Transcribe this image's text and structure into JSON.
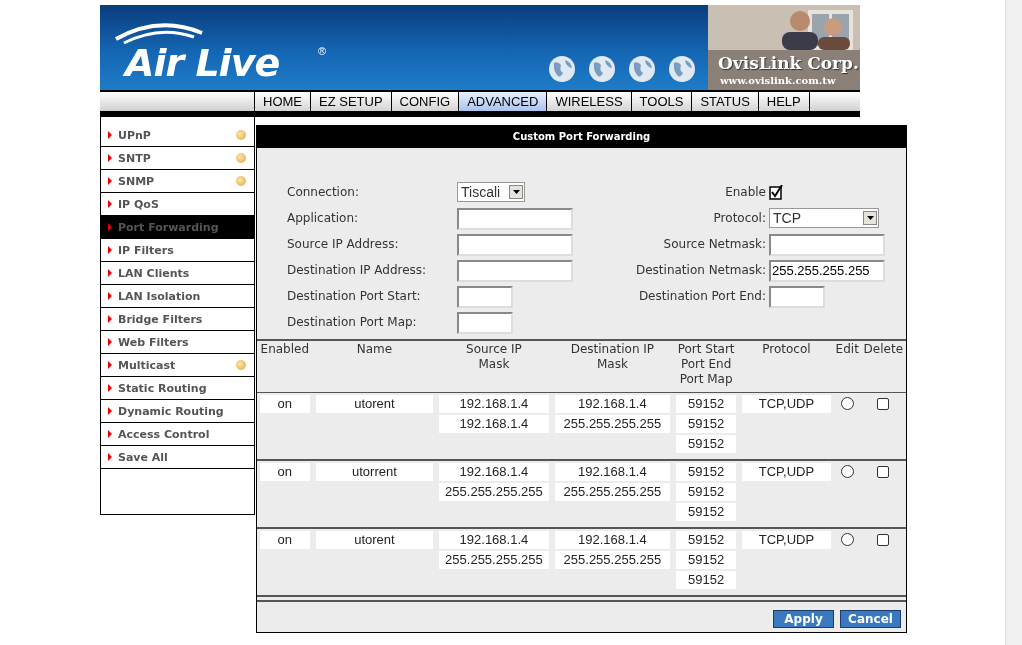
{
  "header": {
    "logo": "Air Live",
    "logo_mark": "®",
    "company": "OvisLink Corp.",
    "website": "www.ovislink.com.tw"
  },
  "tabs": [
    {
      "label": "HOME",
      "selected": false
    },
    {
      "label": "EZ SETUP",
      "selected": false
    },
    {
      "label": "CONFIG",
      "selected": false
    },
    {
      "label": "ADVANCED",
      "selected": true
    },
    {
      "label": "WIRELESS",
      "selected": false
    },
    {
      "label": "TOOLS",
      "selected": false
    },
    {
      "label": "STATUS",
      "selected": false
    },
    {
      "label": "HELP",
      "selected": false
    }
  ],
  "sidebar": {
    "items": [
      {
        "label": "UPnP",
        "selected": false,
        "dot": true
      },
      {
        "label": "SNTP",
        "selected": false,
        "dot": true
      },
      {
        "label": "SNMP",
        "selected": false,
        "dot": true
      },
      {
        "label": "IP QoS",
        "selected": false,
        "dot": false
      },
      {
        "label": "Port Forwarding",
        "selected": true,
        "dot": false
      },
      {
        "label": "IP Filters",
        "selected": false,
        "dot": false
      },
      {
        "label": "LAN Clients",
        "selected": false,
        "dot": false
      },
      {
        "label": "LAN Isolation",
        "selected": false,
        "dot": false
      },
      {
        "label": "Bridge Filters",
        "selected": false,
        "dot": false
      },
      {
        "label": "Web Filters",
        "selected": false,
        "dot": false
      },
      {
        "label": "Multicast",
        "selected": false,
        "dot": true
      },
      {
        "label": "Static Routing",
        "selected": false,
        "dot": false
      },
      {
        "label": "Dynamic Routing",
        "selected": false,
        "dot": false
      },
      {
        "label": "Access Control",
        "selected": false,
        "dot": false
      },
      {
        "label": "Save All",
        "selected": false,
        "dot": false
      }
    ]
  },
  "panel": {
    "title": "Custom Port Forwarding",
    "connection": {
      "label": "Connection:",
      "value": "Tiscali"
    },
    "enable": {
      "label": "Enable",
      "checked": true
    },
    "field_rows": [
      {
        "left": {
          "label": "Application:",
          "kind": "text"
        },
        "right": {
          "label": "Protocol:",
          "value": "TCP",
          "kind": "select"
        }
      },
      {
        "left": {
          "label": "Source IP Address:",
          "kind": "text"
        },
        "right": {
          "label": "Source Netmask:",
          "kind": "text"
        }
      },
      {
        "left": {
          "label": "Destination IP Address:",
          "kind": "text"
        },
        "right": {
          "label": "Destination Netmask:",
          "value": "255.255.255.255",
          "kind": "text"
        }
      },
      {
        "left": {
          "label": "Destination Port Start:",
          "kind": "port"
        },
        "right": {
          "label": "Destination Port End:",
          "kind": "port"
        }
      },
      {
        "left": {
          "label": "Destination Port Map:",
          "kind": "port"
        }
      }
    ],
    "table": {
      "columns": [
        "Enabled",
        "Name",
        "Source IP\nMask",
        "Destination IP\nMask",
        "Port Start\nPort End\nPort Map",
        "Protocol",
        "Edit",
        "Delete"
      ],
      "rows": [
        {
          "enabled": "on",
          "name": "utorent",
          "source_ip": "192.168.1.4",
          "source_mask": "192.168.1.4",
          "dest_ip": "192.168.1.4",
          "dest_mask": "255.255.255.255",
          "port_start": "59152",
          "port_end": "59152",
          "port_map": "59152",
          "protocol": "TCP,UDP",
          "edit_selected": false,
          "delete_checked": false
        },
        {
          "enabled": "on",
          "name": "utorrent",
          "source_ip": "192.168.1.4",
          "source_mask": "255.255.255.255",
          "dest_ip": "192.168.1.4",
          "dest_mask": "255.255.255.255",
          "port_start": "59152",
          "port_end": "59152",
          "port_map": "59152",
          "protocol": "TCP,UDP",
          "edit_selected": false,
          "delete_checked": false
        },
        {
          "enabled": "on",
          "name": "utorent",
          "source_ip": "192.168.1.4",
          "source_mask": "255.255.255.255",
          "dest_ip": "192.168.1.4",
          "dest_mask": "255.255.255.255",
          "port_start": "59152",
          "port_end": "59152",
          "port_map": "59152",
          "protocol": "TCP,UDP",
          "edit_selected": false,
          "delete_checked": false
        }
      ]
    },
    "buttons": [
      "Apply",
      "Cancel"
    ]
  }
}
